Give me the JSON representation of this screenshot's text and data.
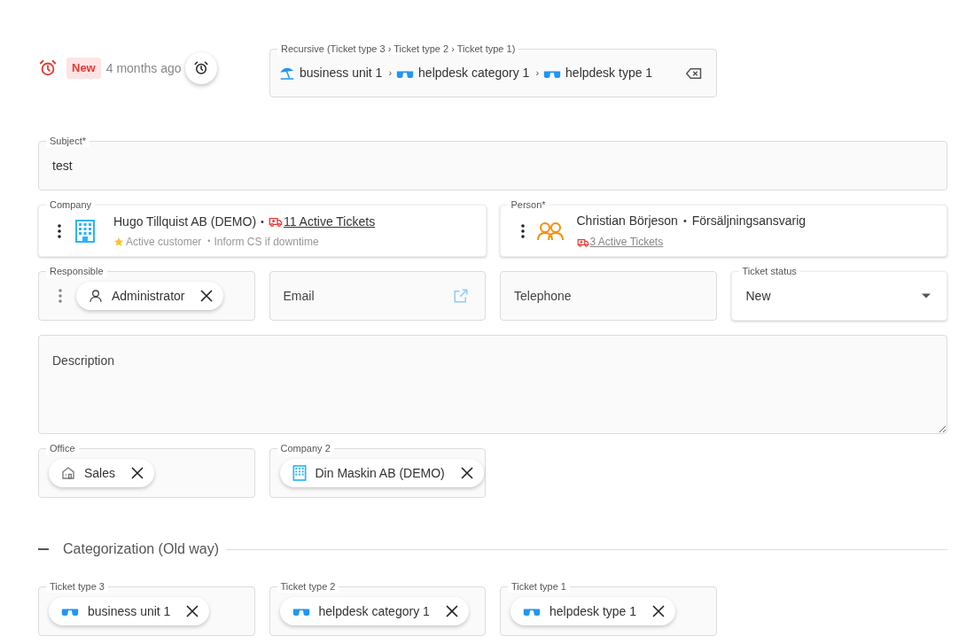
{
  "header": {
    "badge": "New",
    "age": "4 months ago"
  },
  "recursive": {
    "label": "Recursive (Ticket type 3 › Ticket type 2 › Ticket type 1)",
    "separator": "›",
    "path": [
      {
        "kind": "umbrella",
        "label": "business unit 1"
      },
      {
        "kind": "glasses",
        "label": "helpdesk category 1"
      },
      {
        "kind": "glasses",
        "label": "helpdesk type 1"
      }
    ]
  },
  "subject": {
    "label": "Subject*",
    "value": "test"
  },
  "company": {
    "label": "Company",
    "name": "Hugo Tillquist AB (DEMO)",
    "dot": "•",
    "tickets": "11 Active Tickets",
    "tags": [
      "Active customer",
      "Inform CS if downtime"
    ],
    "tag_dot": "•"
  },
  "person": {
    "label": "Person*",
    "name": "Christian Börjeson",
    "dot": "•",
    "role": "Försäljningsansvarig",
    "tickets": "3 Active Tickets"
  },
  "fields": [
    {
      "kind": "chip",
      "label": "Responsible",
      "chip": {
        "kind": "person",
        "text": "Administrator"
      }
    },
    {
      "kind": "email",
      "placeholder": "Email"
    },
    {
      "kind": "text",
      "placeholder": "Telephone"
    },
    {
      "kind": "select",
      "label": "Ticket status",
      "value": "New"
    }
  ],
  "description": {
    "placeholder": "Description"
  },
  "extra_fields": [
    {
      "label": "Office",
      "chip": {
        "kind": "house",
        "text": "Sales"
      }
    },
    {
      "label": "Company 2",
      "chip": {
        "kind": "building",
        "text": "Din Maskin AB (DEMO)"
      }
    }
  ],
  "categorization": {
    "title": "Categorization (Old way)",
    "expanded": true,
    "fields": [
      {
        "label": "Ticket type 3",
        "chip": {
          "kind": "glasses",
          "text": "business unit 1"
        }
      },
      {
        "label": "Ticket type 2",
        "chip": {
          "kind": "glasses",
          "text": "helpdesk category 1"
        }
      },
      {
        "label": "Ticket type 1",
        "chip": {
          "kind": "glasses",
          "text": "helpdesk type 1"
        }
      }
    ]
  }
}
